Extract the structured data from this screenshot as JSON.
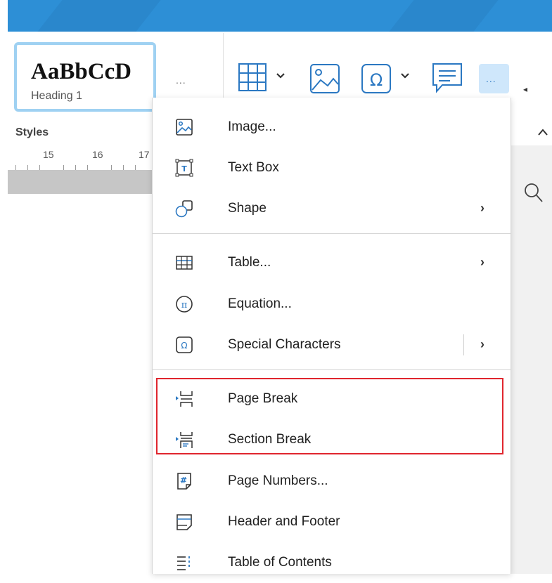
{
  "styles_gallery": {
    "sample_text": "AaBbCcD",
    "style_name": "Heading 1",
    "more_label": "...",
    "group_label": "Styles"
  },
  "ruler": {
    "numbers": [
      "15",
      "16",
      "17"
    ]
  },
  "toolbar": {
    "more_label": "..."
  },
  "menu": {
    "items": [
      {
        "label": "Image...",
        "icon": "image-icon"
      },
      {
        "label": "Text Box",
        "icon": "text-box-icon"
      },
      {
        "label": "Shape",
        "icon": "shape-icon",
        "has_submenu": true
      },
      {
        "label": "Table...",
        "icon": "table-icon",
        "has_submenu": true
      },
      {
        "label": "Equation...",
        "icon": "equation-icon"
      },
      {
        "label": "Special Characters",
        "icon": "special-characters-icon",
        "has_submenu": true
      },
      {
        "label": "Page Break",
        "icon": "page-break-icon"
      },
      {
        "label": "Section Break",
        "icon": "section-break-icon"
      },
      {
        "label": "Page Numbers...",
        "icon": "page-numbers-icon"
      },
      {
        "label": "Header and Footer",
        "icon": "header-footer-icon"
      },
      {
        "label": "Table of Contents",
        "icon": "table-of-contents-icon"
      }
    ],
    "submenu_arrow": "›"
  },
  "colors": {
    "accent": "#2d8fd6",
    "highlight_box": "#e0262e",
    "icon_blue": "#2b78c2"
  }
}
